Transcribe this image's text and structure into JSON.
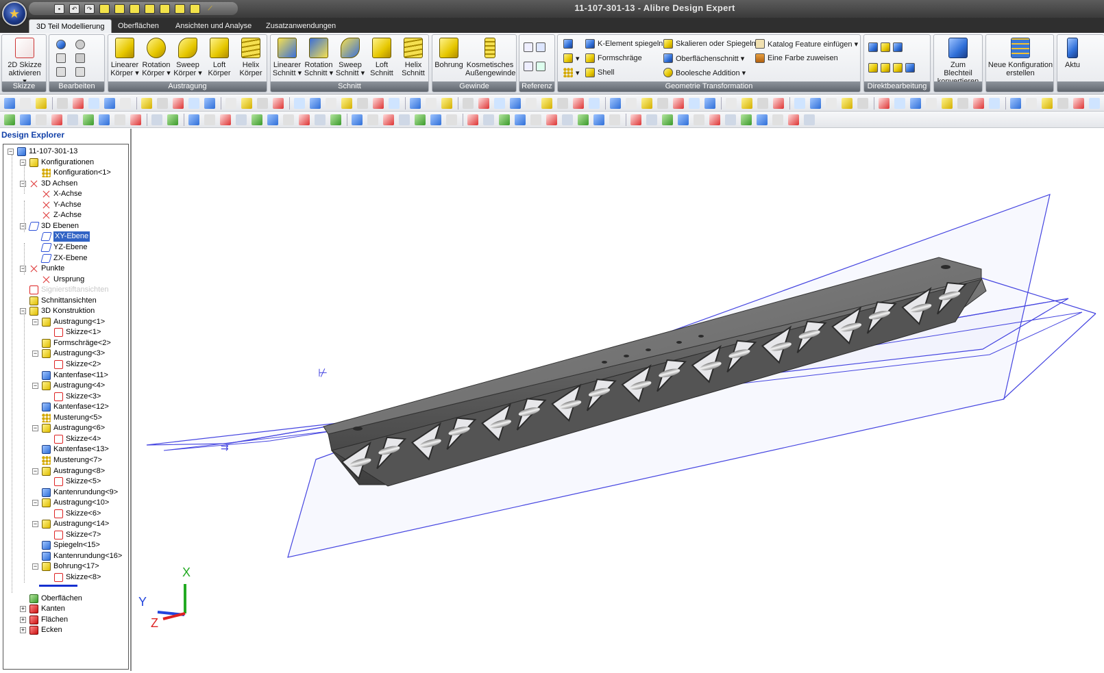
{
  "window": {
    "title": "11-107-301-13 - Alibre Design Expert"
  },
  "quick_access": {
    "undo": "↶",
    "redo": "↷"
  },
  "tabs": [
    {
      "label": "3D Teil Modellierung"
    },
    {
      "label": "Oberflächen"
    },
    {
      "label": "Ansichten und Analyse"
    },
    {
      "label": "Zusatzanwendungen"
    }
  ],
  "ribbon": {
    "skizze": {
      "label": "Skizze",
      "btn1": "2D Skizze",
      "btn2": "aktivieren ▾"
    },
    "bearbeiten": {
      "label": "Bearbeiten"
    },
    "austragung": {
      "label": "Austragung",
      "buttons": [
        {
          "l1": "Linearer",
          "l2": "Körper ▾"
        },
        {
          "l1": "Rotation",
          "l2": "Körper ▾"
        },
        {
          "l1": "Sweep",
          "l2": "Körper ▾"
        },
        {
          "l1": "Loft",
          "l2": "Körper"
        },
        {
          "l1": "Helix",
          "l2": "Körper"
        }
      ]
    },
    "schnitt": {
      "label": "Schnitt",
      "buttons": [
        {
          "l1": "Linearer",
          "l2": "Schnitt ▾"
        },
        {
          "l1": "Rotation",
          "l2": "Schnitt ▾"
        },
        {
          "l1": "Sweep",
          "l2": "Schnitt ▾"
        },
        {
          "l1": "Loft",
          "l2": "Schnitt"
        },
        {
          "l1": "Helix",
          "l2": "Schnitt"
        }
      ]
    },
    "gewinde": {
      "label": "Gewinde",
      "b1": "Bohrung",
      "b2l1": "Kosmetisches",
      "b2l2": "Außengewinde"
    },
    "referenz": {
      "label": "Referenz"
    },
    "geometrie": {
      "label": "Geometrie Transformation",
      "items": [
        "K-Element spiegeln",
        "Formschräge",
        "Shell",
        "Skalieren oder Spiegeln",
        "Oberflächenschnitt ▾",
        "Boolesche Addition ▾",
        "Katalog Feature einfügen ▾",
        "Eine Farbe zuweisen"
      ]
    },
    "direkt": {
      "label": "Direktbearbeitung"
    },
    "blech": {
      "l1": "Zum Blechteil",
      "l2": "konvertieren"
    },
    "konfig": {
      "l1": "Neue Konfiguration",
      "l2": "erstellen"
    },
    "akt": {
      "l1": "Aktu"
    }
  },
  "explorer": {
    "title": "Design Explorer",
    "nodes": [
      {
        "label": "11-107-301-13"
      },
      {
        "label": "Konfigurationen"
      },
      {
        "label": "Konfiguration<1>"
      },
      {
        "label": "3D Achsen"
      },
      {
        "label": "X-Achse"
      },
      {
        "label": "Y-Achse"
      },
      {
        "label": "Z-Achse"
      },
      {
        "label": "3D Ebenen"
      },
      {
        "label": "XY-Ebene"
      },
      {
        "label": "YZ-Ebene"
      },
      {
        "label": "ZX-Ebene"
      },
      {
        "label": "Punkte"
      },
      {
        "label": "Ursprung"
      },
      {
        "label": "Signierstiftansichten"
      },
      {
        "label": "Schnittansichten"
      },
      {
        "label": "3D Konstruktion"
      },
      {
        "label": "Austragung<1>"
      },
      {
        "label": "Skizze<1>"
      },
      {
        "label": "Formschräge<2>"
      },
      {
        "label": "Austragung<3>"
      },
      {
        "label": "Skizze<2>"
      },
      {
        "label": "Kantenfase<11>"
      },
      {
        "label": "Austragung<4>"
      },
      {
        "label": "Skizze<3>"
      },
      {
        "label": "Kantenfase<12>"
      },
      {
        "label": "Musterung<5>"
      },
      {
        "label": "Austragung<6>"
      },
      {
        "label": "Skizze<4>"
      },
      {
        "label": "Kantenfase<13>"
      },
      {
        "label": "Musterung<7>"
      },
      {
        "label": "Austragung<8>"
      },
      {
        "label": "Skizze<5>"
      },
      {
        "label": "Kantenrundung<9>"
      },
      {
        "label": "Austragung<10>"
      },
      {
        "label": "Skizze<6>"
      },
      {
        "label": "Austragung<14>"
      },
      {
        "label": "Skizze<7>"
      },
      {
        "label": "Spiegeln<15>"
      },
      {
        "label": "Kantenrundung<16>"
      },
      {
        "label": "Bohrung<17>"
      },
      {
        "label": "Skizze<8>"
      },
      {
        "label": "Oberflächen"
      },
      {
        "label": "Kanten"
      },
      {
        "label": "Flächen"
      },
      {
        "label": "Ecken"
      }
    ]
  },
  "triad": {
    "x": "X",
    "y": "Y",
    "z": "Z"
  },
  "colors": {
    "accent": "#3163c5",
    "plane": "#3a3adf",
    "part": "#6c6c6c",
    "selection": "#3163c5"
  }
}
